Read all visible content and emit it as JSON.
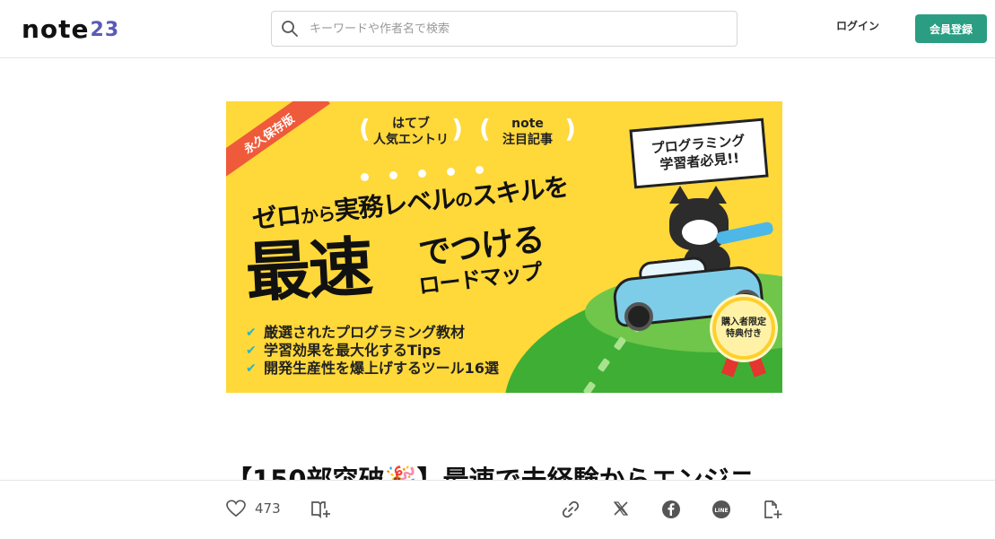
{
  "header": {
    "logo_text": "note",
    "logo_sup": "23",
    "search_placeholder": "キーワードや作者名で検索",
    "login_label": "ログイン",
    "register_label": "会員登録"
  },
  "banner": {
    "ribbon": "永久保存版",
    "award1_line1": "はてブ",
    "award1_line2": "人気エントリ",
    "award2_line1": "note",
    "award2_line2": "注目記事",
    "speech_line1": "プログラミング",
    "speech_line2": "学習者必見!!",
    "headline_part1": "ゼロ",
    "headline_part2": "から",
    "headline_part3": "実務レベル",
    "headline_part4": "の",
    "headline_part5": "スキルを",
    "headline_big": "最速",
    "headline_mid": "でつける",
    "headline_small": "ロードマップ",
    "checks": [
      "厳選されたプログラミング教材",
      "学習効果を最大化するTips",
      "開発生産性を爆上げするツール16選"
    ],
    "badge_line1": "購入者限定",
    "badge_line2": "特典付き"
  },
  "article": {
    "title": "【150部突破🎉】最速で未経験からエンジニ"
  },
  "actions": {
    "like_count": "473"
  },
  "colors": {
    "brand_green": "#2a9d82",
    "banner_yellow": "#ffd83a",
    "ribbon_red": "#ef5a3a"
  }
}
